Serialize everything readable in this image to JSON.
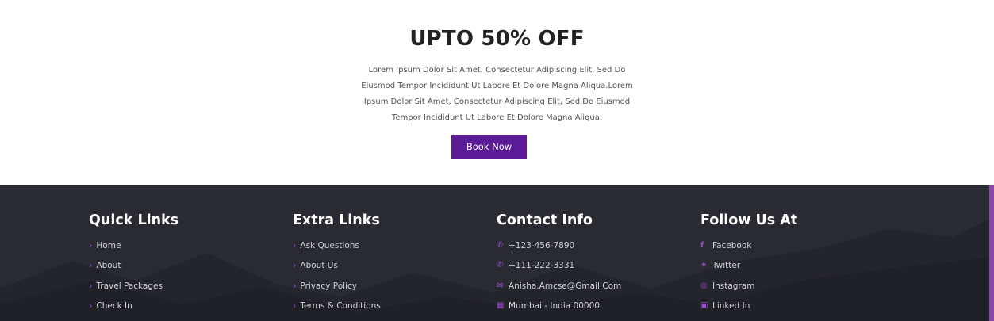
{
  "promo": {
    "title": "UPTO 50% OFF",
    "description": "Lorem Ipsum Dolor Sit Amet, Consectetur Adipiscing Elit, Sed Do Eiusmod Tempor Incididunt Ut Labore Et Dolore Magna Aliqua.Lorem Ipsum Dolor Sit Amet, Consectetur Adipiscing Elit, Sed Do Eiusmod Tempor Incididunt Ut Labore Et Dolore Magna Aliqua.",
    "button_label": "Book Now",
    "button_color": "#5b1a96"
  },
  "footer": {
    "background": "#2a2a33",
    "accent": "#9b4fd0",
    "quick_links": {
      "title": "Quick Links",
      "items": [
        "Home",
        "About",
        "Travel Packages",
        "Check In"
      ]
    },
    "extra_links": {
      "title": "Extra Links",
      "items": [
        "Ask Questions",
        "About Us",
        "Privacy Policy",
        "Terms & Conditions"
      ]
    },
    "contact_info": {
      "title": "Contact Info",
      "items": [
        {
          "icon": "phone-icon",
          "text": "+123-456-7890"
        },
        {
          "icon": "phone-icon",
          "text": "+111-222-3331"
        },
        {
          "icon": "envelope-icon",
          "text": "Anisha.Amcse@Gmail.Com"
        },
        {
          "icon": "map-icon",
          "text": "Mumbai - India 00000"
        }
      ]
    },
    "follow_us": {
      "title": "Follow Us At",
      "items": [
        {
          "icon": "facebook-icon",
          "text": "Facebook"
        },
        {
          "icon": "twitter-icon",
          "text": "Twitter"
        },
        {
          "icon": "instagram-icon",
          "text": "Instagram"
        },
        {
          "icon": "linkedin-icon",
          "text": "Linked In"
        }
      ]
    }
  }
}
